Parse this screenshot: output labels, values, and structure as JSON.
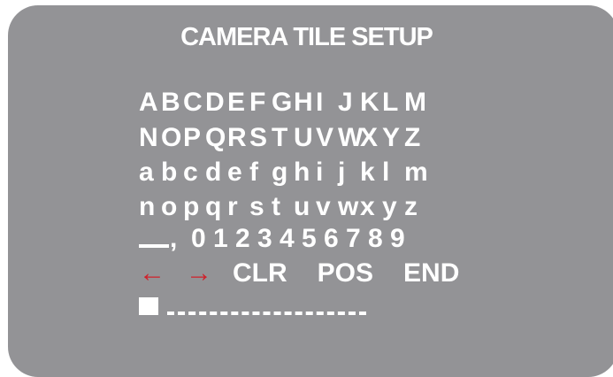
{
  "title": "CAMERA TILE SETUP",
  "upper_row_1": [
    "A",
    "B",
    "C",
    "D",
    "E",
    "F",
    "G",
    "H",
    "I",
    "J",
    "K",
    "L",
    "M"
  ],
  "upper_row_2": [
    "N",
    "O",
    "P",
    "Q",
    "R",
    "S",
    "T",
    "U",
    "V",
    "W",
    "X",
    "Y",
    "Z"
  ],
  "lower_row_1": [
    "a",
    "b",
    "c",
    "d",
    "e",
    "f",
    "g",
    "h",
    "i",
    "j",
    "k",
    "l",
    "m"
  ],
  "lower_row_2": [
    "n",
    "o",
    "p",
    "q",
    "r",
    "s",
    "t",
    "u",
    "v",
    "w",
    "x",
    "y",
    "z"
  ],
  "symbols": {
    "comma": ","
  },
  "digits": [
    "0",
    "1",
    "2",
    "3",
    "4",
    "5",
    "6",
    "7",
    "8",
    "9"
  ],
  "controls": {
    "left_arrow": "←",
    "right_arrow": "→",
    "clear": "CLR",
    "position": "POS",
    "end": "END"
  },
  "colors": {
    "panel": "#939396",
    "text": "#ffffff",
    "arrows": "#d0202a"
  }
}
